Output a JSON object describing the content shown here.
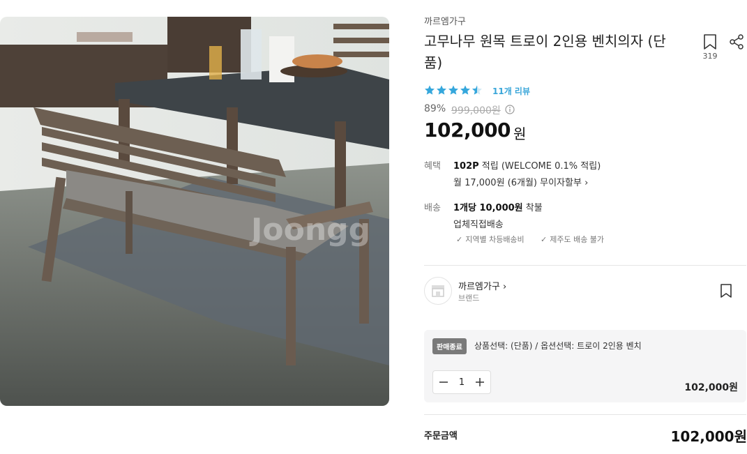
{
  "product": {
    "brand": "까르엠가구",
    "title": "고무나무 원목 트로이 2인용 벤치의자 (단품)",
    "bookmark_count": "319",
    "rating_value": 4.5,
    "review_link": "11개 리뷰",
    "discount": "89%",
    "original_price": "999,000원",
    "price": "102,000",
    "price_unit": "원",
    "image_alt": "wooden bench with gray cushion next to dining table",
    "watermark": "Joongg"
  },
  "benefit": {
    "label": "혜택",
    "points": "102P",
    "points_suffix": " 적립 (WELCOME 0.1% 적립)",
    "installment": "월 17,000원 (6개월) 무이자할부"
  },
  "shipping": {
    "label": "배송",
    "fee_prefix": "1개당 10,000원",
    "fee_suffix": " 착불",
    "method": "업체직접배송",
    "notes": [
      "지역별 차등배송비",
      "제주도 배송 불가"
    ]
  },
  "store": {
    "name": "까르엠가구",
    "type": "브랜드"
  },
  "option": {
    "badge": "판매종료",
    "text": "상품선택: (단품) / 옵션선택: 트로이 2인용 벤치",
    "quantity": "1",
    "price": "102,000원"
  },
  "order": {
    "label": "주문금액",
    "total": "102,000원"
  },
  "colors": {
    "star": "#35a7dc",
    "review": "#3aa6d9",
    "badge": "#7a7a7a"
  }
}
